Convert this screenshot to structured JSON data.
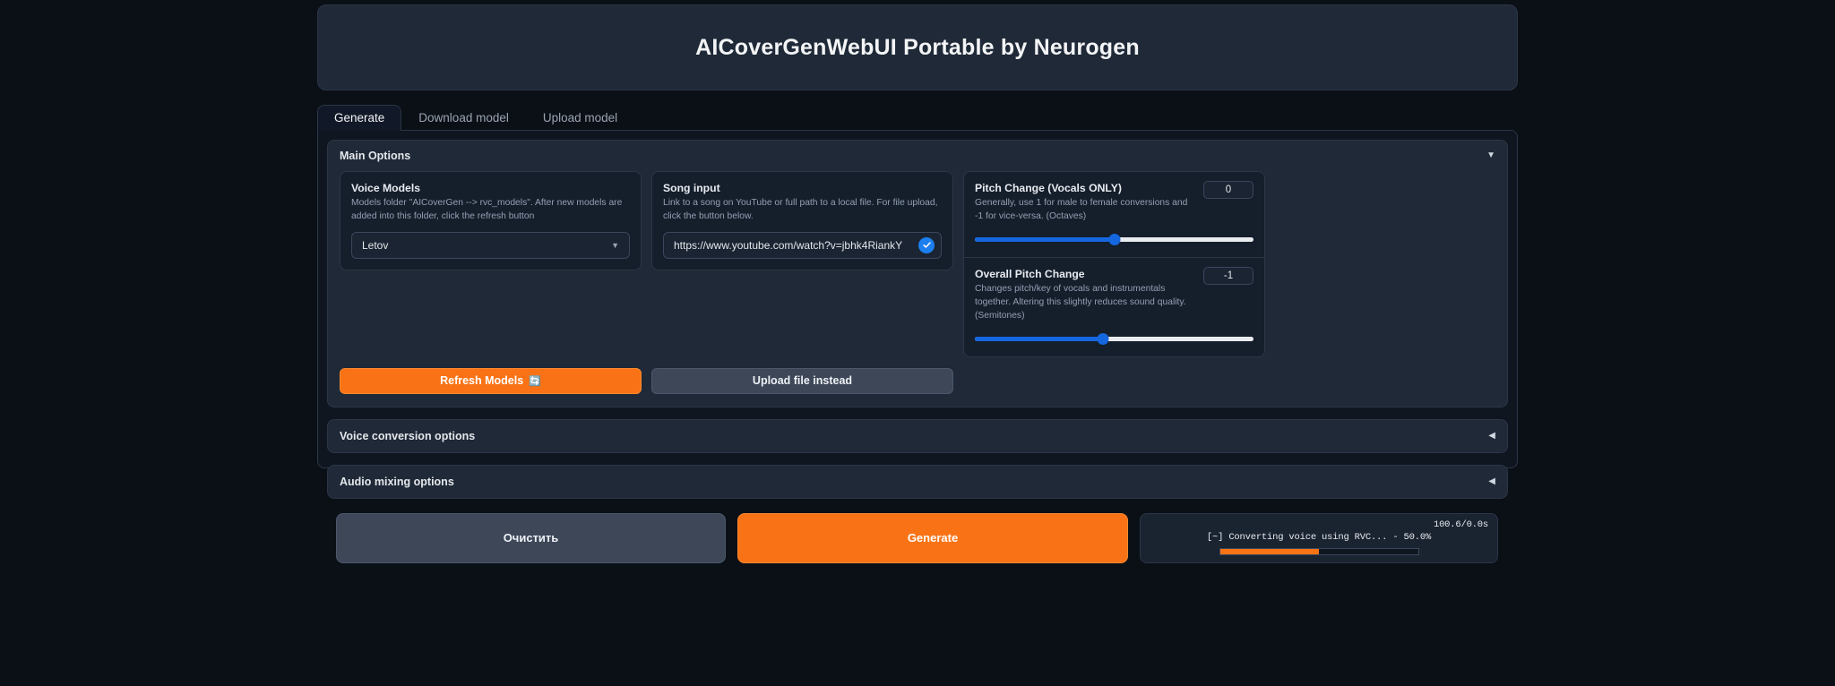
{
  "header": {
    "title": "AICoverGenWebUI Portable by Neurogen"
  },
  "tabs": [
    {
      "label": "Generate",
      "active": true
    },
    {
      "label": "Download model",
      "active": false
    },
    {
      "label": "Upload model",
      "active": false
    }
  ],
  "main_options": {
    "title": "Main Options",
    "caret": "▼",
    "voice_models": {
      "label": "Voice Models",
      "info": "Models folder \"AICoverGen --> rvc_models\". After new models are added into this folder, click the refresh button",
      "selected": "Letov",
      "dropdown_arrow": "▼",
      "refresh_button": "Refresh Models",
      "refresh_icon": "🔄"
    },
    "song_input": {
      "label": "Song input",
      "info": "Link to a song on YouTube or full path to a local file. For file upload, click the button below.",
      "value": "https://www.youtube.com/watch?v=jbhk4RiankY",
      "placeholder": "",
      "upload_button": "Upload file instead"
    },
    "pitch_change_vocals": {
      "label": "Pitch Change (Vocals ONLY)",
      "info": "Generally, use 1 for male to female conversions and -1 for vice-versa. (Octaves)",
      "value": "0",
      "slider_percent": 50
    },
    "overall_pitch_change": {
      "label": "Overall Pitch Change",
      "info": "Changes pitch/key of vocals and instrumentals together. Altering this slightly reduces sound quality. (Semitones)",
      "value": "-1",
      "slider_percent": 46
    }
  },
  "sections": [
    {
      "title": "Voice conversion options",
      "caret": "◀"
    },
    {
      "title": "Audio mixing options",
      "caret": "◀"
    }
  ],
  "actions": {
    "clear_label": "Очистить",
    "generate_label": "Generate"
  },
  "status": {
    "timer": "100.6/0.0s",
    "message": "[~] Converting voice using RVC... - 50.0%",
    "progress_percent": 50
  },
  "colors": {
    "accent_orange": "#f97316",
    "accent_blue": "#1567e0",
    "page_bg": "#0b0f16",
    "panel_bg": "#1f2937"
  }
}
